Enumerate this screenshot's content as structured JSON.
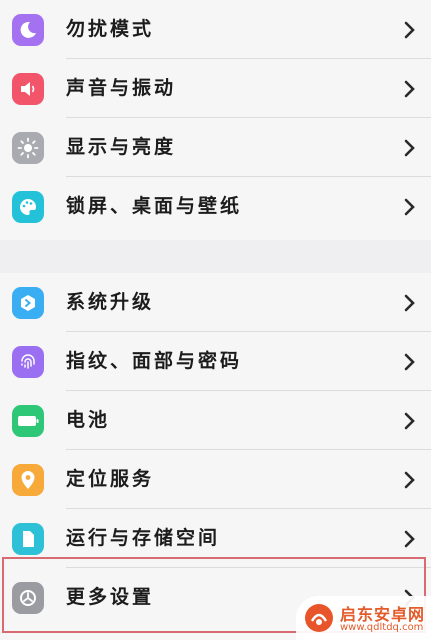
{
  "settings_group_1": [
    {
      "label": "勿扰模式",
      "icon": "moon-icon",
      "color": "#a472f0"
    },
    {
      "label": "声音与振动",
      "icon": "speaker-icon",
      "color": "#f2546a"
    },
    {
      "label": "显示与亮度",
      "icon": "sun-icon",
      "color": "#a9abb1"
    },
    {
      "label": "锁屏、桌面与壁纸",
      "icon": "palette-icon",
      "color": "#24c2d8"
    }
  ],
  "settings_group_2": [
    {
      "label": "系统升级",
      "icon": "system-update-icon",
      "color": "#3aaef2"
    },
    {
      "label": "指纹、面部与密码",
      "icon": "fingerprint-icon",
      "color": "#9b6ff2"
    },
    {
      "label": "电池",
      "icon": "battery-icon",
      "color": "#2dc777"
    },
    {
      "label": "定位服务",
      "icon": "location-pin-icon",
      "color": "#f7a93a"
    },
    {
      "label": "运行与存储空间",
      "icon": "storage-icon",
      "color": "#2ec0d6"
    },
    {
      "label": "更多设置",
      "icon": "gear-icon",
      "color": "#9a9ca2"
    }
  ],
  "watermark": {
    "title": "启东安卓网",
    "url": "www.qdltdq.com"
  }
}
